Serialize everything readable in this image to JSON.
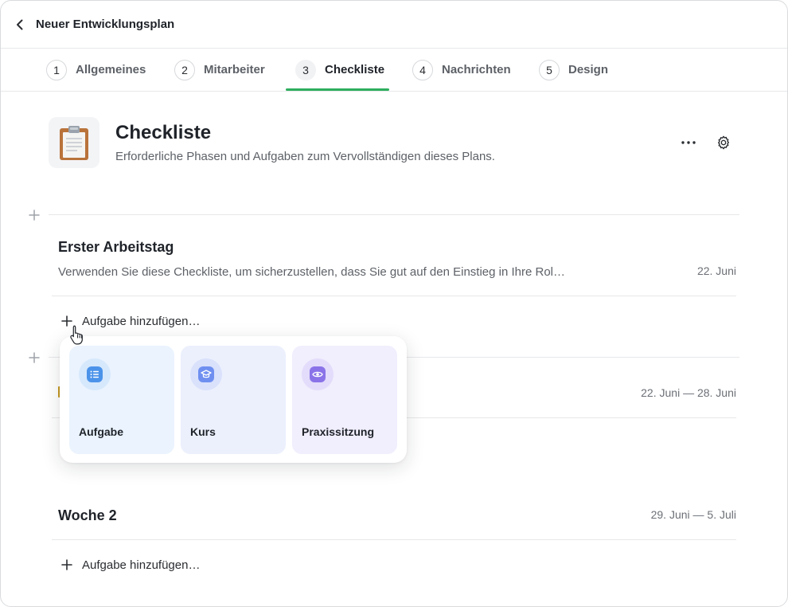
{
  "header": {
    "title": "Neuer Entwicklungsplan",
    "back_icon": "chevron-left-icon"
  },
  "tabs": [
    {
      "num": "1",
      "label": "Allgemeines"
    },
    {
      "num": "2",
      "label": "Mitarbeiter"
    },
    {
      "num": "3",
      "label": "Checkliste",
      "active": true
    },
    {
      "num": "4",
      "label": "Nachrichten"
    },
    {
      "num": "5",
      "label": "Design"
    }
  ],
  "accent_color": "#2eae5e",
  "section": {
    "icon": "clipboard-icon",
    "title": "Checkliste",
    "subtitle": "Erforderliche Phasen und Aufgaben zum Vervollständigen dieses Plans."
  },
  "groups": [
    {
      "title": "Erster Arbeitstag",
      "description": "Verwenden Sie diese Checkliste, um sicherzustellen, dass Sie gut auf den Einstieg in Ihre Rol…",
      "date": "22. Juni",
      "add_task_label": "Aufgabe hinzufügen…"
    },
    {
      "title": "",
      "date": "22. Juni — 28. Juni"
    },
    {
      "title": "Woche 2",
      "date": "29. Juni — 5. Juli",
      "add_task_label": "Aufgabe hinzufügen…"
    }
  ],
  "popover": {
    "options": [
      {
        "label": "Aufgabe",
        "icon": "list-icon",
        "bg": "#eaf3fe",
        "icon_bg": "#d6e8fc",
        "icon_color": "#4b93ea"
      },
      {
        "label": "Kurs",
        "icon": "graduation-cap-icon",
        "bg": "#ecf0fd",
        "icon_bg": "#d9e1fb",
        "icon_color": "#6f8ff0"
      },
      {
        "label": "Praxissitzung",
        "icon": "eye-icon",
        "bg": "#f1eefd",
        "icon_bg": "#e3dcfb",
        "icon_color": "#8a73e8"
      }
    ]
  }
}
